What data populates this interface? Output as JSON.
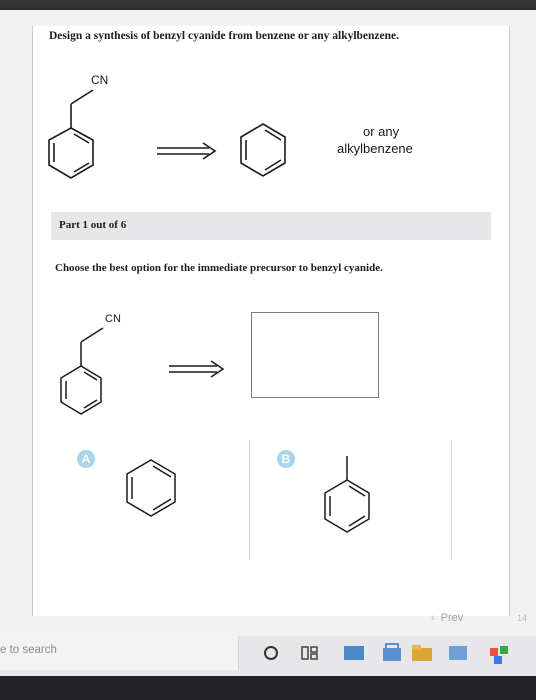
{
  "question": "Design a synthesis of benzyl cyanide from benzene or any alkylbenzene.",
  "top_diagram": {
    "cn_label": "CN",
    "or_any": "or any",
    "alkylbenzene": "alkylbenzene"
  },
  "part_label": "Part 1 out of 6",
  "prompt": "Choose the best option for the immediate precursor to benzyl cyanide.",
  "mid_diagram": {
    "cn_label": "CN"
  },
  "options": [
    {
      "letter": "A"
    },
    {
      "letter": "B"
    }
  ],
  "nav": {
    "prev_label": "Prev",
    "page_number": "14"
  },
  "taskbar": {
    "search_placeholder": "e to search"
  },
  "colors": {
    "badge": "#a9d4ea",
    "part_bar": "#e7e7ea",
    "prev_link": "#9aa3ad"
  }
}
